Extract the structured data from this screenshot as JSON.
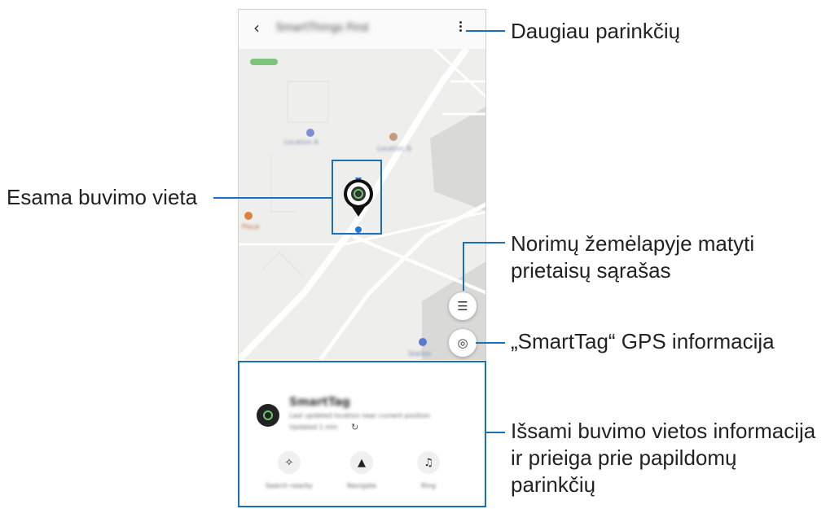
{
  "phone": {
    "title": "SmartThings Find",
    "back_icon": "chevron-left-icon",
    "more_icon": "more-vertical-icon"
  },
  "map": {
    "labels": [
      "Location A",
      "Location B",
      "Place",
      "Station"
    ]
  },
  "sheet": {
    "device_name": "SmartTag",
    "device_detail": "Last updated location near current position",
    "device_detail2": "Updated 1 min",
    "actions": [
      {
        "icon": "search-nearby-icon",
        "label": "Search nearby"
      },
      {
        "icon": "navigate-icon",
        "label": "Navigate"
      },
      {
        "icon": "ring-icon",
        "label": "Ring"
      }
    ]
  },
  "callouts": {
    "more_options": "Daugiau parinkčių",
    "current_location": "Esama buvimo vieta",
    "device_list_1": "Norimų žemėlapyje matyti",
    "device_list_2": "prietaisų sąrašas",
    "gps_info": "„SmartTag“ GPS informacija",
    "details_1": "Išsami buvimo vietos informacija",
    "details_2": "ir prieiga prie papildomų",
    "details_3": "parinkčių"
  },
  "colors": {
    "accent": "#1a6fb5",
    "map_bg": "#eeeeec",
    "tag_ring": "#6ec46e"
  }
}
